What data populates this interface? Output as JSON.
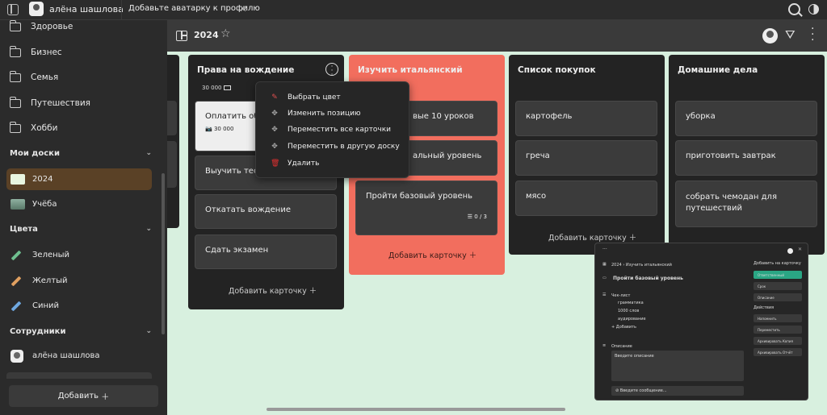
{
  "topbar": {
    "user": "алёна шашлова",
    "tab": "Добавьте аватарку к профилю",
    "tab_close": "✕"
  },
  "sidebar": {
    "folders": [
      "Здоровье",
      "Бизнес",
      "Семья",
      "Путешествия",
      "Хобби"
    ],
    "boards_section": "Мои доски",
    "boards": [
      {
        "label": "2024",
        "color": "#e8f5e0"
      },
      {
        "label": "Учёба",
        "color": "#7a9a8a"
      }
    ],
    "colors_section": "Цвета",
    "colors": [
      {
        "label": "Зеленый",
        "color": "#6fbf8f"
      },
      {
        "label": "Желтый",
        "color": "#e0a060"
      },
      {
        "label": "Синий",
        "color": "#6fa8e0"
      }
    ],
    "staff_section": "Сотрудники",
    "staff": [
      "алёна шашлова"
    ],
    "add_button": "Добавить"
  },
  "header": {
    "title": "2024"
  },
  "columns": [
    {
      "title": "Права на вождение",
      "budget": "30 000",
      "cards": [
        {
          "text": "Оплатить об",
          "badge": "30 000"
        },
        {
          "text": "Выучить теор"
        },
        {
          "text": "Откатать вождение"
        },
        {
          "text": "Сдать экзамен"
        }
      ],
      "add": "Добавить карточку"
    },
    {
      "title": "Изучить итальянский",
      "cards": [
        {
          "text": "вые 10 уроков"
        },
        {
          "text": "альный уровень"
        },
        {
          "text": "Пройти базовый уровень",
          "badge": "0 / 3"
        }
      ],
      "add": "Добавить карточку"
    },
    {
      "title": "Список покупок",
      "cards": [
        {
          "text": "картофель"
        },
        {
          "text": "греча"
        },
        {
          "text": "мясо"
        }
      ],
      "add": "Добавить карточку"
    },
    {
      "title": "Домашние дела",
      "cards": [
        {
          "text": "уборка"
        },
        {
          "text": "приготовить завтрак"
        },
        {
          "text": "собрать чемодан для путешествий"
        }
      ]
    }
  ],
  "menu": [
    "Выбрать цвет",
    "Изменить позицию",
    "Переместить все карточки",
    "Переместить в другую доску",
    "Удалить"
  ],
  "modal": {
    "crumb": "2024 › Изучить итальянский",
    "title": "Пройти базовый уровень",
    "checklist_label": "Чек-лист",
    "checklist": [
      "грамматика",
      "1000 слов",
      "аудирование"
    ],
    "add_item": "Добавить",
    "desc_label": "Описание",
    "desc_placeholder": "Введите описание",
    "comment_placeholder": "Введите сообщение...",
    "side_title": "Добавить на карточку",
    "side_buttons": [
      "Ответственный",
      "Срок",
      "Описание"
    ],
    "actions_title": "Действия",
    "actions": [
      "Напомнить",
      "Переместить",
      "Архивировать Копия",
      "Архивировать Отчёт"
    ]
  }
}
